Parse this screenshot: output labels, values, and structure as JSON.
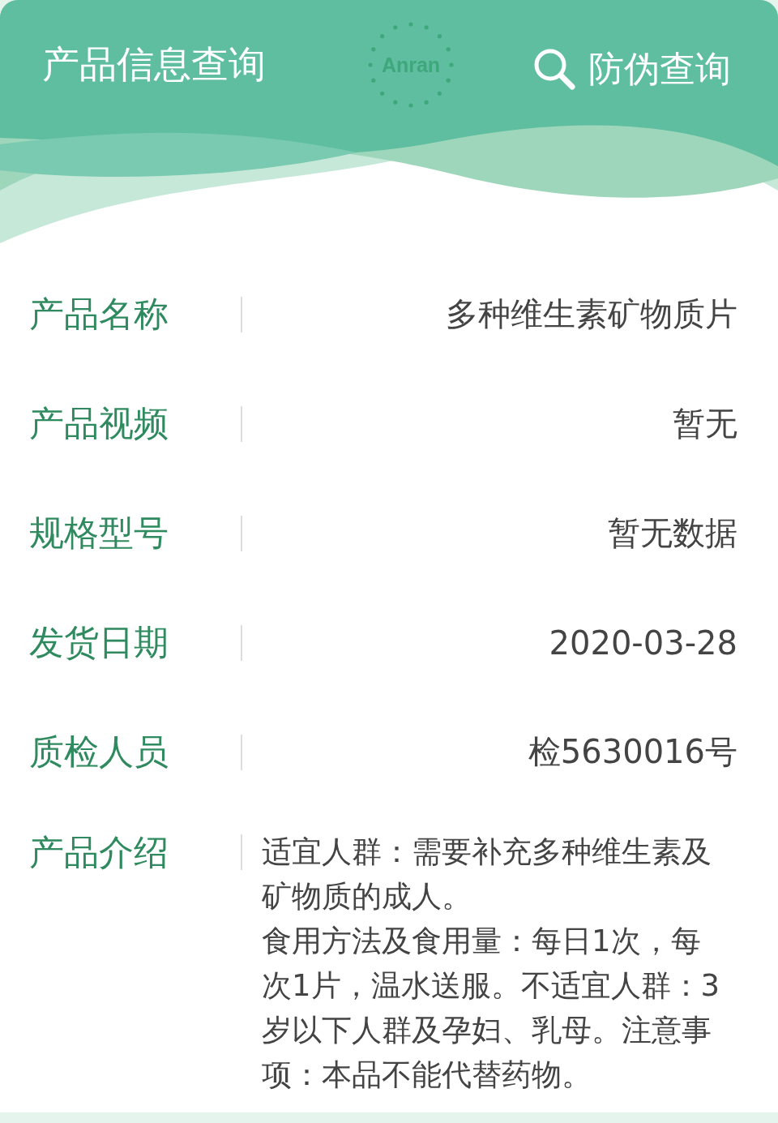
{
  "header": {
    "title": "产品信息查询",
    "logo": "Anran",
    "search_link": "防伪查询"
  },
  "fields": [
    {
      "label": "产品名称",
      "value": "多种维生素矿物质片"
    },
    {
      "label": "产品视频",
      "value": "暂无"
    },
    {
      "label": "规格型号",
      "value": "暂无数据"
    },
    {
      "label": "发货日期",
      "value": "2020-03-28"
    },
    {
      "label": "质检人员",
      "value": "检5630016号"
    }
  ],
  "introduction": {
    "label": "产品介绍",
    "paragraphs": [
      "适宜人群：需要补充多种维生素及矿物质的成人。",
      "食用方法及食用量：每日1次，每次1片，温水送服。不适宜人群：3岁以下人群及孕妇、乳母。注意事项：本品不能代替药物。"
    ]
  }
}
